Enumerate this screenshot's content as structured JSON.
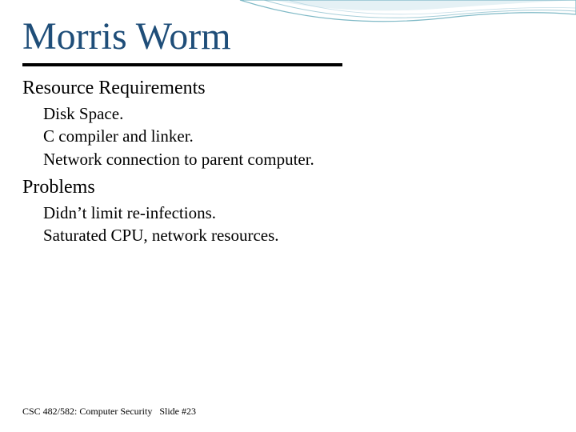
{
  "title": "Morris Worm",
  "sections": [
    {
      "heading": "Resource Requirements",
      "items": [
        "Disk Space.",
        "C compiler and linker.",
        "Network connection to parent computer."
      ]
    },
    {
      "heading": "Problems",
      "items": [
        "Didn’t limit re-infections.",
        "Saturated CPU, network resources."
      ]
    }
  ],
  "footer": {
    "course": "CSC 482/582: Computer Security",
    "slide": "Slide #23"
  }
}
